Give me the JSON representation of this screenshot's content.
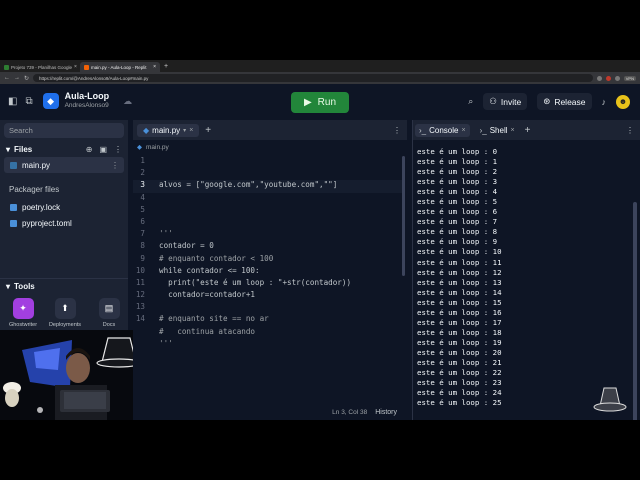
{
  "browser": {
    "tabs": [
      {
        "label": "Projeto 739 - Planilhas Google",
        "active": false
      },
      {
        "label": "main.py - Aula-Loop - Replit",
        "active": true
      }
    ],
    "url": "https://replit.com/@AndresAlonso9/Aula-Loop#main.py",
    "vpn_label": "VPN"
  },
  "header": {
    "project_name": "Aula-Loop",
    "owner": "AndresAlonso9",
    "run_label": "Run",
    "invite_label": "Invite",
    "release_label": "Release",
    "avatar_letter": "☻"
  },
  "sidebar": {
    "search_placeholder": "Search",
    "files_title": "Files",
    "files": [
      {
        "name": "main.py",
        "selected": true
      }
    ],
    "packager_title": "Packager files",
    "packager_files": [
      {
        "name": "poetry.lock"
      },
      {
        "name": "pyproject.toml"
      }
    ],
    "tools_title": "Tools",
    "tools": [
      {
        "label": "Ghostwriter",
        "color": "#a23fe0"
      },
      {
        "label": "Deployments",
        "color": "#2b3245"
      },
      {
        "label": "Docs",
        "color": "#2b3245"
      }
    ]
  },
  "editor": {
    "tab_label": "main.py",
    "breadcrumb": "main.py",
    "lines": [
      {
        "n": "1",
        "text": ""
      },
      {
        "n": "2",
        "text": ""
      },
      {
        "n": "3",
        "text": "alvos = [\"google.com\",\"youtube.com\",\"\"]"
      },
      {
        "n": "4",
        "text": ""
      },
      {
        "n": "5",
        "text": ""
      },
      {
        "n": "6",
        "text": ""
      },
      {
        "n": "7",
        "text": "'''"
      },
      {
        "n": "8",
        "text": "contador = 0"
      },
      {
        "n": "9",
        "text": "# enquanto contador < 100"
      },
      {
        "n": "10",
        "text": "while contador <= 100:"
      },
      {
        "n": "11",
        "text": "  print(\"este é um loop : \"+str(contador))"
      },
      {
        "n": "12",
        "text": "  contador=contador+1"
      },
      {
        "n": "13",
        "text": ""
      },
      {
        "n": "14",
        "text": "# enquanto site == no ar"
      },
      {
        "n": "",
        "text": "#   continua atacando"
      },
      {
        "n": "",
        "text": "'''"
      }
    ],
    "cursor_position": "Ln 3, Col 38",
    "history_label": "History"
  },
  "console": {
    "tabs": [
      {
        "label": "Console",
        "active": true
      },
      {
        "label": "Shell",
        "active": false
      }
    ],
    "output": [
      "este é um loop : 0",
      "este é um loop : 1",
      "este é um loop : 2",
      "este é um loop : 3",
      "este é um loop : 4",
      "este é um loop : 5",
      "este é um loop : 6",
      "este é um loop : 7",
      "este é um loop : 8",
      "este é um loop : 9",
      "este é um loop : 10",
      "este é um loop : 11",
      "este é um loop : 12",
      "este é um loop : 13",
      "este é um loop : 14",
      "este é um loop : 15",
      "este é um loop : 16",
      "este é um loop : 17",
      "este é um loop : 18",
      "este é um loop : 19",
      "este é um loop : 20",
      "este é um loop : 21",
      "este é um loop : 22",
      "este é um loop : 23",
      "este é um loop : 24",
      "este é um loop : 25"
    ]
  },
  "colors": {
    "run": "#22863a",
    "bg": "#0e1525",
    "panel": "#1c2333",
    "accent": "#1f6feb"
  }
}
